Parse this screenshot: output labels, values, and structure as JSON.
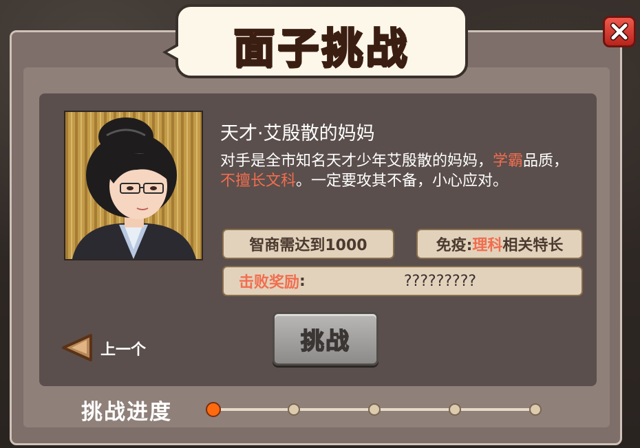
{
  "dialog": {
    "title": "面子挑战",
    "close_icon": "close-x-icon"
  },
  "opponent": {
    "name": "天才·艾殷散的妈妈",
    "description_parts": {
      "p1": "对手是全市知名天才少年艾殷散的妈妈，",
      "hl1": "学霸",
      "p2": "品质，",
      "hl2": "不擅长文科",
      "p3": "。一定要攻其不备，小心应对。"
    }
  },
  "requirements": {
    "iq": "智商需达到1000",
    "immune_prefix": "免疫:",
    "immune_highlight": "理科",
    "immune_suffix": "相关特长",
    "reward_label": "击败奖励",
    "reward_colon": ":",
    "reward_value": "?????????"
  },
  "actions": {
    "challenge_label": "挑战",
    "prev_label": "上一个"
  },
  "progress": {
    "label": "挑战进度",
    "total": 5,
    "current": 1
  },
  "colors": {
    "highlight": "#f26d4f",
    "active_node": "#ff6a0e",
    "close_button": "#d83a2f"
  }
}
